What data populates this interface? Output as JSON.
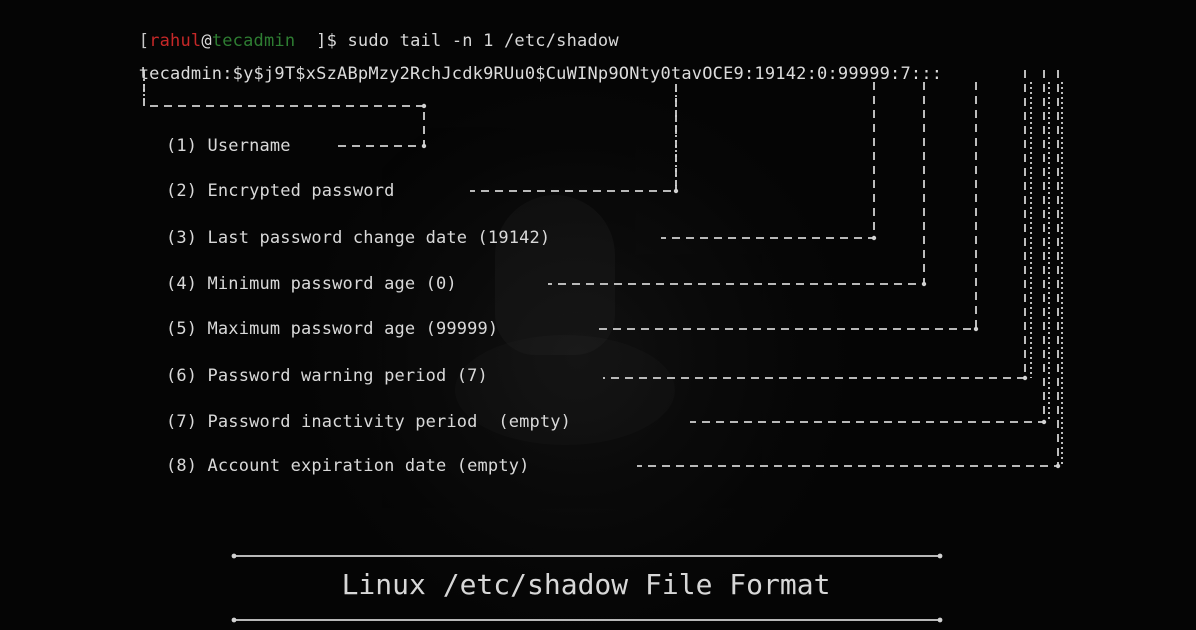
{
  "prompt": {
    "open_bracket": "[",
    "user": "rahul",
    "at": "@",
    "host": "tecadmin",
    "space": "  ",
    "close_and_command": "]$ sudo tail -n 1 /etc/shadow"
  },
  "shadow_entry": "tecadmin:$y$j9T$xSzABpMzy2RchJcdk9RUu0$CuWINp9ONty0tavOCE9:19142:0:99999:7:::",
  "fields": [
    {
      "label": "(1) Username"
    },
    {
      "label": "(2) Encrypted password"
    },
    {
      "label": "(3) Last password change date (19142)"
    },
    {
      "label": "(4) Minimum password age (0)"
    },
    {
      "label": "(5) Maximum password age (99999)"
    },
    {
      "label": "(6) Password warning period (7)"
    },
    {
      "label": "(7) Password inactivity period  (empty)"
    },
    {
      "label": "(8) Account expiration date (empty)"
    }
  ],
  "footer": {
    "title": "Linux /etc/shadow File Format"
  },
  "colors": {
    "background": "#050505",
    "text": "#d8d8d8",
    "user": "#c62828",
    "host": "#2e7d32"
  }
}
